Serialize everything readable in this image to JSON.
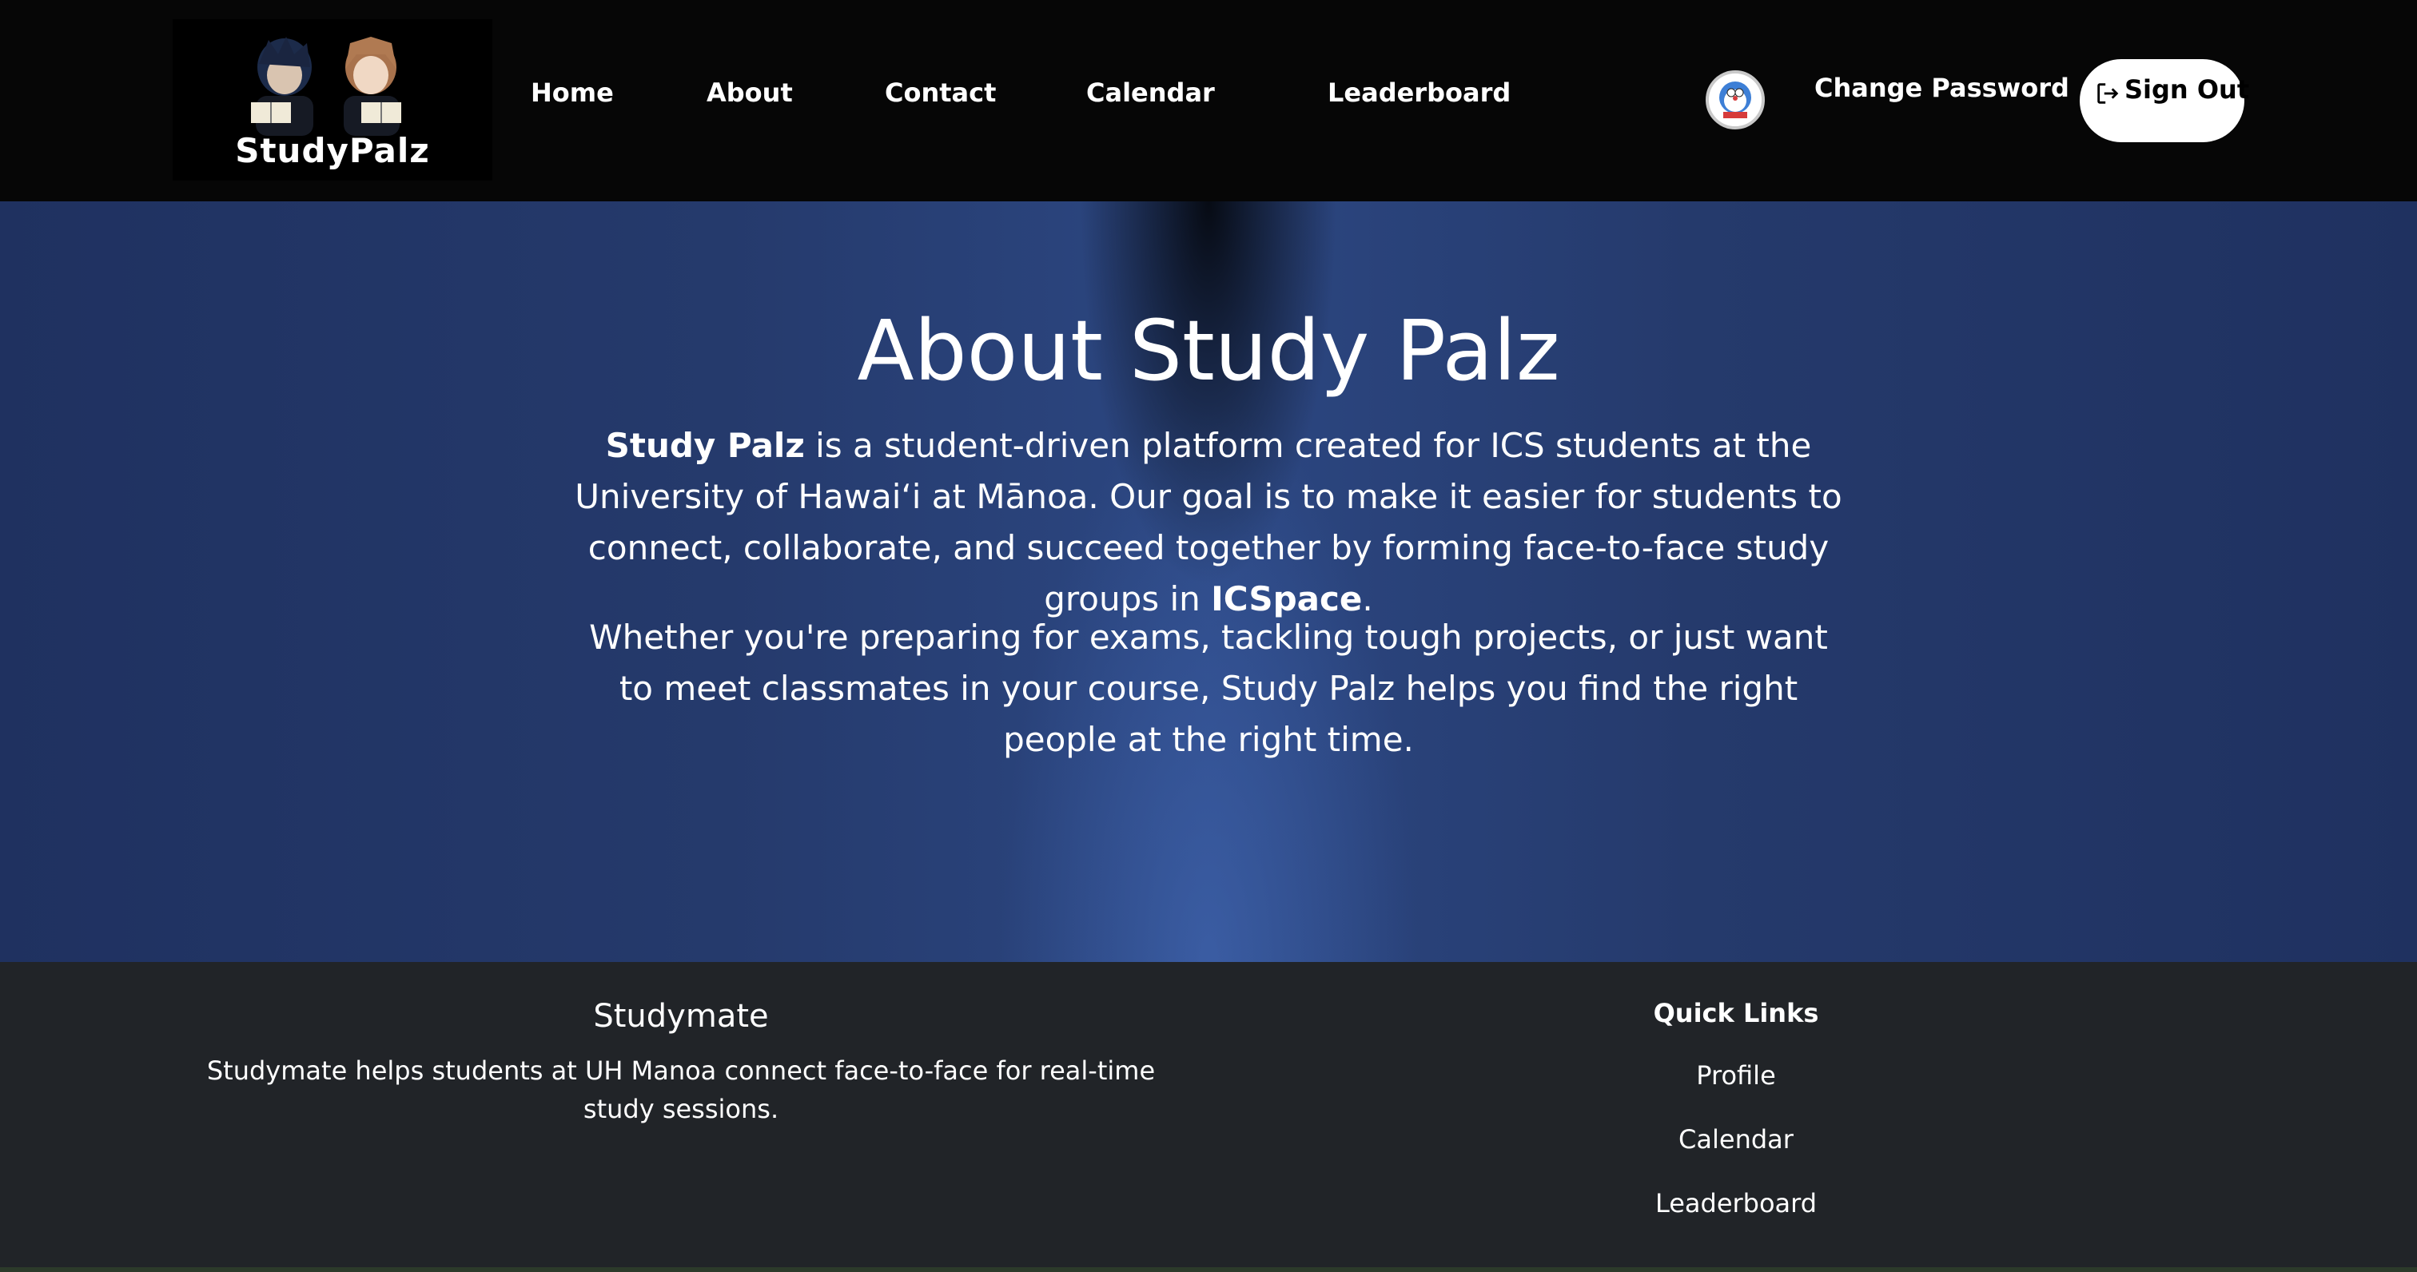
{
  "navbar": {
    "logo_text": "StudyPalz",
    "links": [
      "Home",
      "About",
      "Contact",
      "Calendar",
      "Leaderboard"
    ],
    "change_password": "Change Password",
    "sign_out": "Sign Out"
  },
  "hero": {
    "title": "About Study Palz",
    "p1_bold_start": "Study Palz",
    "p1_text": " is a student-driven platform created for ICS students at the University of Hawaiʻi at Mānoa. Our goal is to make it easier for students to connect, collaborate, and succeed together by forming face-to-face study groups in ",
    "p1_bold_end": "ICSpace",
    "p1_end": ".",
    "p2": "Whether you're preparing for exams, tackling tough projects, or just want to meet classmates in your course, Study Palz helps you find the right people at the right time."
  },
  "footer": {
    "title": "Studymate",
    "description": "Studymate helps students at UH Manoa connect face-to-face for real-time study sessions.",
    "quick_links_title": "Quick Links",
    "quick_links": [
      "Profile",
      "Calendar",
      "Leaderboard"
    ]
  }
}
